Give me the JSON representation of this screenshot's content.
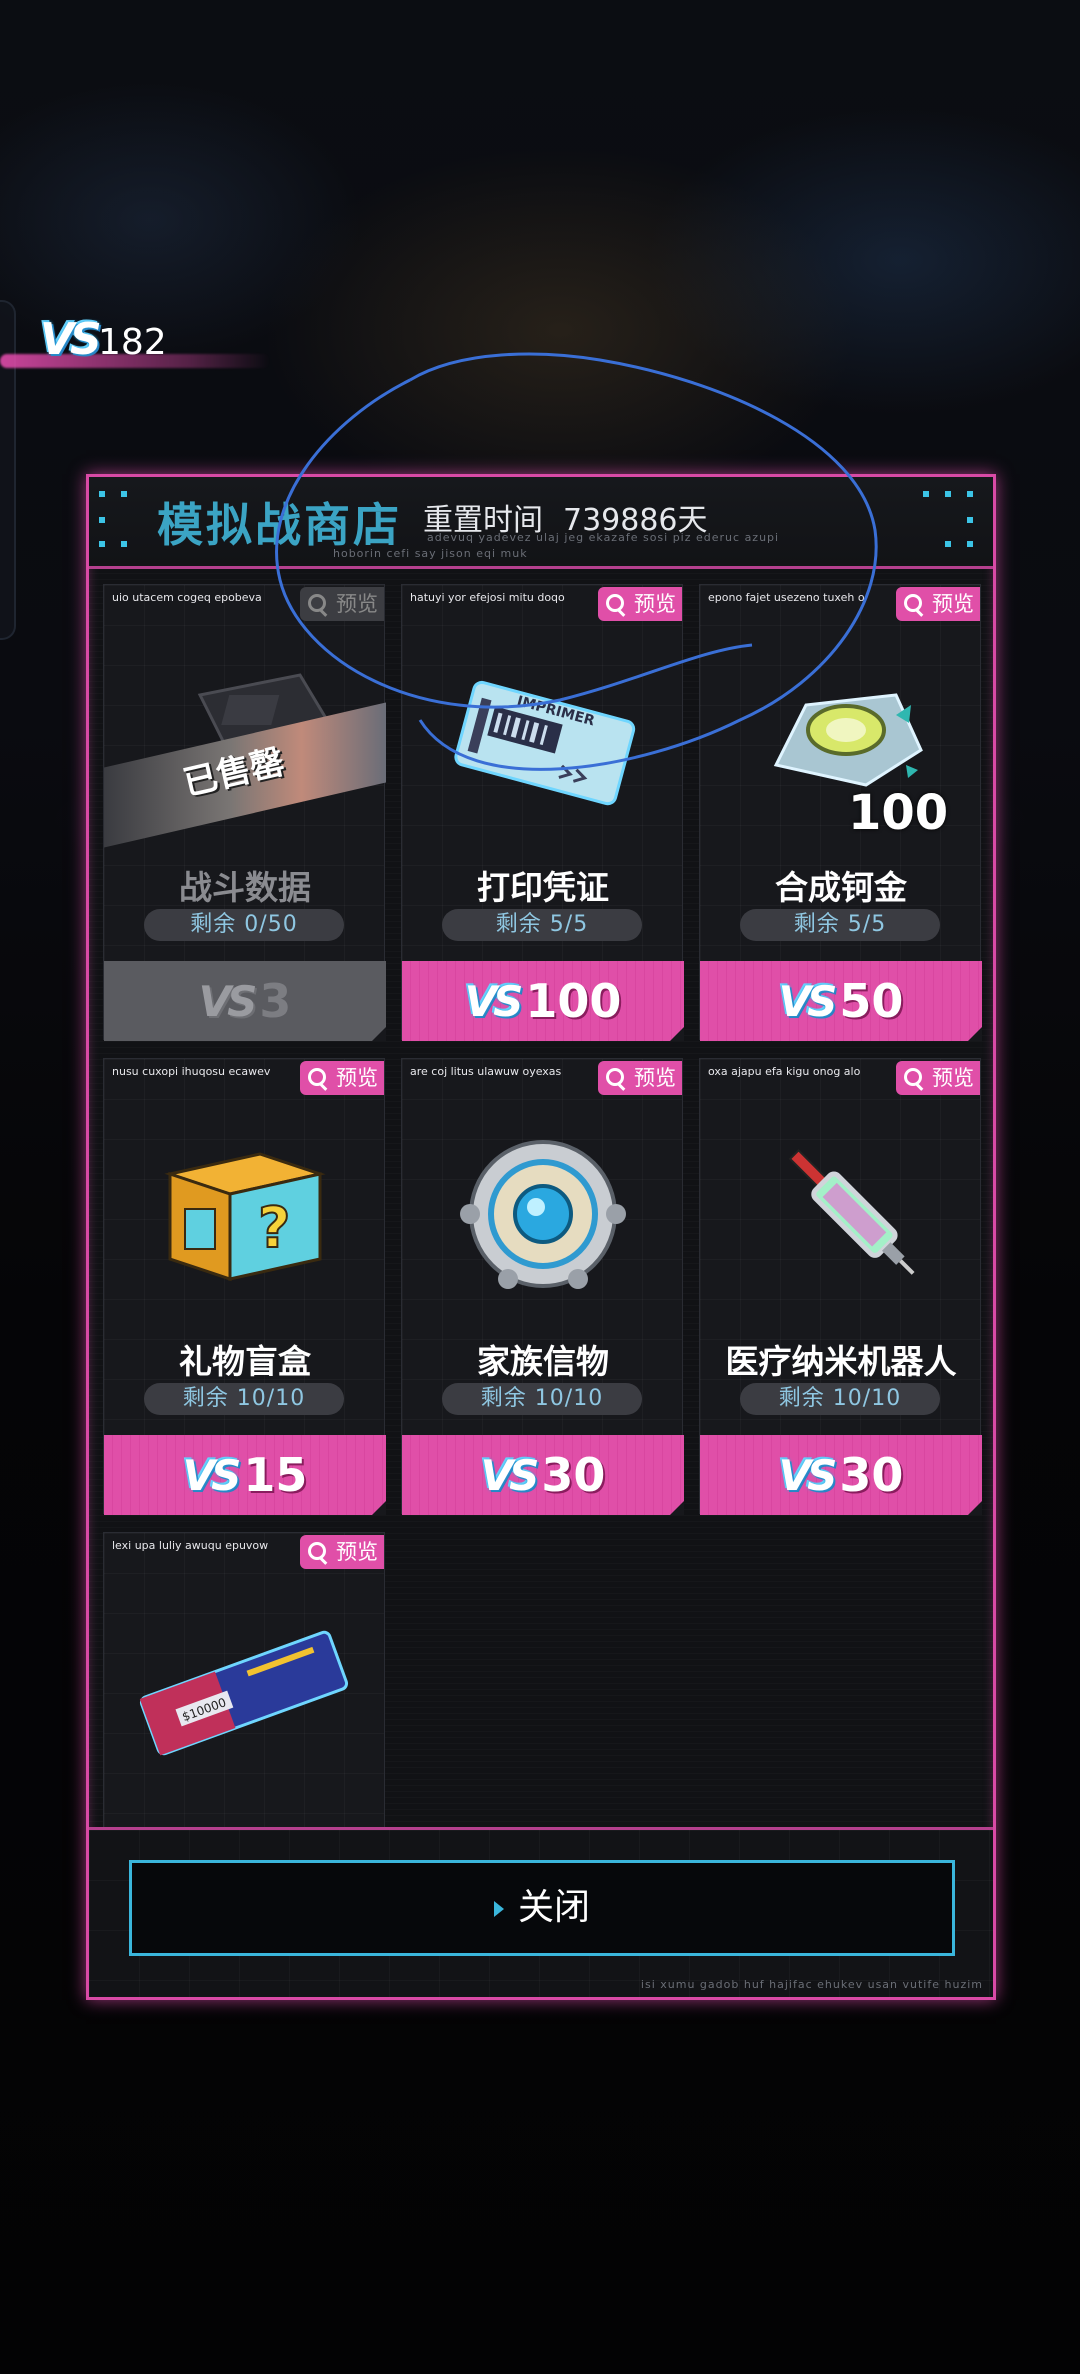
{
  "currency": {
    "icon": "vs-token-icon",
    "amount": "182"
  },
  "shop": {
    "title": "模拟战商店",
    "reset_label": "重置时间",
    "reset_value": "739886天",
    "subtitle": "adevuq yadevez ulaj jeg ekazafe sosi piz ederuc azupi",
    "subtitle2": "hoborin cefi say jison eqi muk",
    "currency_symbol": "VS",
    "items": [
      {
        "tagline": "uio utacem cogeq epobeva",
        "preview": "预览",
        "name": "战斗数据",
        "stock": "剩余 0/50",
        "price": "3",
        "sold": true,
        "sold_label": "已售罄"
      },
      {
        "tagline": "hatuyi yor efejosi mitu doqo",
        "preview": "预览",
        "name": "打印凭证",
        "stock": "剩余 5/5",
        "price": "100",
        "sold": false
      },
      {
        "tagline": "epono fajet usezeno tuxeh o",
        "preview": "预览",
        "name": "合成钶金",
        "stock": "剩余 5/5",
        "price": "50",
        "sold": false,
        "badge": "100"
      },
      {
        "tagline": "nusu cuxopi ihuqosu ecawev",
        "preview": "预览",
        "name": "礼物盲盒",
        "stock": "剩余 10/10",
        "price": "15",
        "sold": false
      },
      {
        "tagline": "are coj litus ulawuw oyexas",
        "preview": "预览",
        "name": "家族信物",
        "stock": "剩余 10/10",
        "price": "30",
        "sold": false
      },
      {
        "tagline": "oxa ajapu efa kigu onog alo",
        "preview": "预览",
        "name": "医疗纳米机器人",
        "stock": "剩余 10/10",
        "price": "30",
        "sold": false
      },
      {
        "tagline": "lexi upa luliy awuqu epuvow",
        "preview": "预览",
        "name": "",
        "stock": "",
        "price": "",
        "sold": false
      }
    ]
  },
  "footer": {
    "close_label": "关闭",
    "note": "isi xumu gadob huf hajifac ehukev usan vutife huzim"
  },
  "colors": {
    "accent_pink": "#e04fa8",
    "accent_cyan": "#3ab6dc",
    "title_blue": "#3ba4c4",
    "annotation": "#3a6fd6"
  }
}
